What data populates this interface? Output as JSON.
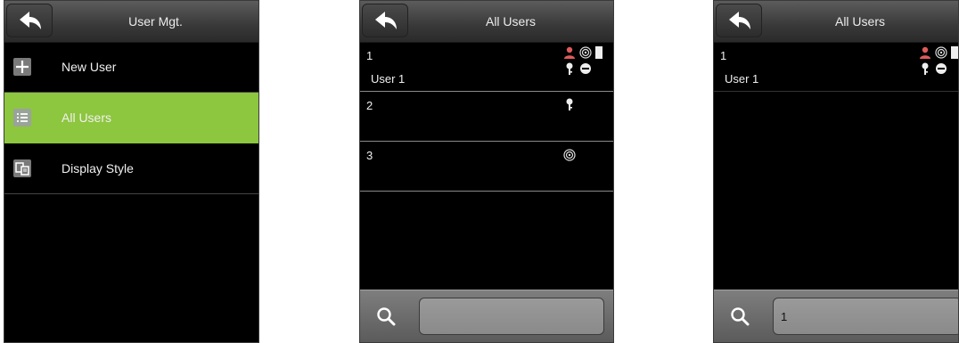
{
  "screens": [
    {
      "title": "User Mgt.",
      "menu": [
        {
          "label": "New User",
          "icon": "plus-icon"
        },
        {
          "label": "All Users",
          "icon": "list-icon",
          "active": true
        },
        {
          "label": "Display Style",
          "icon": "display-style-icon"
        }
      ]
    },
    {
      "title": "All Users",
      "users": [
        {
          "id": "1",
          "name": "User 1"
        },
        {
          "id": "2",
          "name": ""
        },
        {
          "id": "3",
          "name": ""
        }
      ],
      "search_value": ""
    },
    {
      "title": "All Users",
      "users": [
        {
          "id": "1",
          "name": "User 1"
        }
      ],
      "search_value": "1"
    }
  ],
  "colors": {
    "active_item": "#8dc63f",
    "user_icon": "#e05a5a",
    "background": "#000000"
  }
}
